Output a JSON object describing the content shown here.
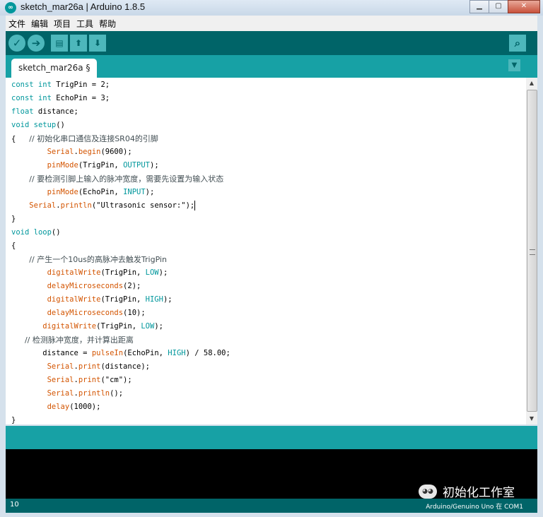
{
  "window": {
    "title": "sketch_mar26a | Arduino 1.8.5"
  },
  "menubar": [
    "文件",
    "编辑",
    "项目",
    "工具",
    "帮助"
  ],
  "toolbar": {
    "verify": "✓",
    "upload": "➔",
    "new": "▤",
    "open": "⬆",
    "save": "⬇",
    "serial_monitor": "⌕"
  },
  "tabs": [
    {
      "label": "sketch_mar26a §"
    }
  ],
  "tab_menu": "▼",
  "code_lines": [
    {
      "indent": "",
      "parts": [
        [
          "kw",
          "const int"
        ],
        [
          "",
          " TrigPin = 2;"
        ]
      ]
    },
    {
      "indent": "",
      "parts": [
        [
          "kw",
          "const int"
        ],
        [
          "",
          " EchoPin = 3;"
        ]
      ]
    },
    {
      "indent": "",
      "parts": [
        [
          "kw",
          "float"
        ],
        [
          "",
          " distance;"
        ]
      ]
    },
    {
      "indent": "",
      "parts": [
        [
          "kw",
          "void"
        ],
        [
          "",
          " "
        ],
        [
          "kw",
          "setup"
        ],
        [
          "",
          "()"
        ]
      ]
    },
    {
      "indent": "",
      "parts": [
        [
          "",
          "{   "
        ],
        [
          "comment",
          "// 初始化串口通信及连接SR04的引脚"
        ]
      ]
    },
    {
      "indent": "        ",
      "parts": [
        [
          "fn",
          "Serial"
        ],
        [
          "",
          "."
        ],
        [
          "fn",
          "begin"
        ],
        [
          "",
          "(9600);"
        ]
      ]
    },
    {
      "indent": "        ",
      "parts": [
        [
          "fn",
          "pinMode"
        ],
        [
          "",
          "(TrigPin, "
        ],
        [
          "const",
          "OUTPUT"
        ],
        [
          "",
          ");"
        ]
      ]
    },
    {
      "indent": "    ",
      "parts": [
        [
          "comment",
          "// 要检测引脚上输入的脉冲宽度，需要先设置为输入状态"
        ]
      ]
    },
    {
      "indent": "        ",
      "parts": [
        [
          "fn",
          "pinMode"
        ],
        [
          "",
          "(EchoPin, "
        ],
        [
          "const",
          "INPUT"
        ],
        [
          "",
          ");"
        ]
      ]
    },
    {
      "indent": "    ",
      "parts": [
        [
          "fn",
          "Serial"
        ],
        [
          "",
          "."
        ],
        [
          "fn",
          "println"
        ],
        [
          "",
          "(\"Ultrasonic sensor:\");"
        ]
      ],
      "cursor": true
    },
    {
      "indent": "",
      "parts": [
        [
          "",
          "}"
        ]
      ]
    },
    {
      "indent": "",
      "parts": [
        [
          "kw",
          "void"
        ],
        [
          "",
          " "
        ],
        [
          "kw",
          "loop"
        ],
        [
          "",
          "()"
        ]
      ]
    },
    {
      "indent": "",
      "parts": [
        [
          "",
          "{"
        ]
      ]
    },
    {
      "indent": "    ",
      "parts": [
        [
          "comment",
          "// 产生一个10us的高脉冲去触发TrigPin"
        ]
      ]
    },
    {
      "indent": "        ",
      "parts": [
        [
          "fn",
          "digitalWrite"
        ],
        [
          "",
          "(TrigPin, "
        ],
        [
          "const",
          "LOW"
        ],
        [
          "",
          ");"
        ]
      ]
    },
    {
      "indent": "        ",
      "parts": [
        [
          "fn",
          "delayMicroseconds"
        ],
        [
          "",
          "(2);"
        ]
      ]
    },
    {
      "indent": "        ",
      "parts": [
        [
          "fn",
          "digitalWrite"
        ],
        [
          "",
          "(TrigPin, "
        ],
        [
          "const",
          "HIGH"
        ],
        [
          "",
          ");"
        ]
      ]
    },
    {
      "indent": "        ",
      "parts": [
        [
          "fn",
          "delayMicroseconds"
        ],
        [
          "",
          "(10);"
        ]
      ]
    },
    {
      "indent": "       ",
      "parts": [
        [
          "fn",
          "digitalWrite"
        ],
        [
          "",
          "(TrigPin, "
        ],
        [
          "const",
          "LOW"
        ],
        [
          "",
          ");"
        ]
      ]
    },
    {
      "indent": "   ",
      "parts": [
        [
          "comment",
          "// 检测脉冲宽度，并计算出距离"
        ]
      ]
    },
    {
      "indent": "       ",
      "parts": [
        [
          "",
          "distance = "
        ],
        [
          "fn",
          "pulseIn"
        ],
        [
          "",
          "(EchoPin, "
        ],
        [
          "const",
          "HIGH"
        ],
        [
          "",
          ") / 58.00;"
        ]
      ]
    },
    {
      "indent": "        ",
      "parts": [
        [
          "fn",
          "Serial"
        ],
        [
          "",
          "."
        ],
        [
          "fn",
          "print"
        ],
        [
          "",
          "(distance);"
        ]
      ]
    },
    {
      "indent": "        ",
      "parts": [
        [
          "fn",
          "Serial"
        ],
        [
          "",
          "."
        ],
        [
          "fn",
          "print"
        ],
        [
          "",
          "(\"cm\");"
        ]
      ]
    },
    {
      "indent": "        ",
      "parts": [
        [
          "fn",
          "Serial"
        ],
        [
          "",
          "."
        ],
        [
          "fn",
          "println"
        ],
        [
          "",
          "();"
        ]
      ]
    },
    {
      "indent": "        ",
      "parts": [
        [
          "fn",
          "delay"
        ],
        [
          "",
          "(1000);"
        ]
      ]
    },
    {
      "indent": "",
      "parts": [
        [
          "",
          "}"
        ]
      ]
    }
  ],
  "status": {
    "line_number": "10",
    "board": "Arduino/Genuino Uno 在 COM1"
  },
  "watermark": {
    "text": "初始化工作室"
  },
  "colors": {
    "teal_dark": "#006468",
    "teal": "#17a1a5",
    "keyword": "#00979c",
    "function": "#d35400"
  }
}
